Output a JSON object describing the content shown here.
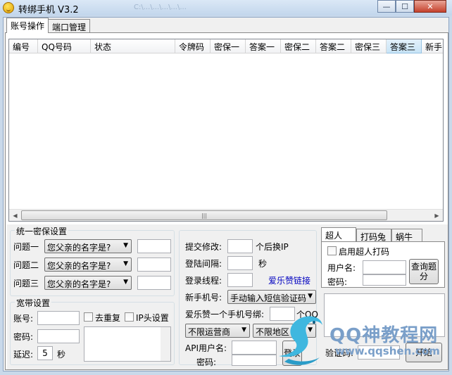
{
  "window": {
    "title": "转绑手机 V3.2",
    "ghost_path": "C:\\...\\...\\...\\...\\...",
    "minimize": "—",
    "maximize": "☐",
    "close": "✕"
  },
  "tabs": [
    "账号操作",
    "端口管理"
  ],
  "table": {
    "columns": [
      "编号",
      "QQ号码",
      "状态",
      "令牌码",
      "密保一",
      "答案一",
      "密保二",
      "答案二",
      "密保三",
      "答案三",
      "新手"
    ],
    "rows": [],
    "scroll_thumb": "|||"
  },
  "security": {
    "title": "统一密保设置",
    "rows": [
      {
        "label": "问题一",
        "question": "您父亲的名字是?",
        "answer": ""
      },
      {
        "label": "问题二",
        "question": "您父亲的名字是?",
        "answer": ""
      },
      {
        "label": "问题三",
        "question": "您父亲的名字是?",
        "answer": ""
      }
    ]
  },
  "broadband": {
    "title": "宽带设置",
    "account_label": "账号:",
    "password_label": "密码:",
    "delay_label": "延迟:",
    "delay_value": "5",
    "delay_unit": "秒",
    "dedupe_label": "去重复",
    "ip_header_label": "IP头设置"
  },
  "submit": {
    "modify_label": "提交修改:",
    "modify_suffix": "个后换IP",
    "login_interval_label": "登陆间隔:",
    "login_interval_unit": "秒",
    "login_thread_label": "登录线程:",
    "aileyun_link": "爱乐赞链接",
    "new_phone_label": "新手机号:",
    "new_phone_mode": "手动输入短信验证码",
    "aileyun_bind_label": "爱乐赞一个手机号绑:",
    "aileyun_bind_suffix": "个QQ",
    "carrier": "不限运营商",
    "region": "不限地区",
    "api_user_label": "API用户名:",
    "api_password_label": "密码:",
    "login_button": "登录"
  },
  "captcha": {
    "tabs": [
      "超人",
      "打码兔",
      "蜗牛"
    ],
    "enable_label": "启用超人打码",
    "username_label": "用户名:",
    "password_label": "密码:",
    "query_button": "查询题分",
    "code_label": "验证码:",
    "start_button": "开始"
  },
  "watermark": {
    "text": "QQ神教程网",
    "url": "www.qqshen.com"
  }
}
